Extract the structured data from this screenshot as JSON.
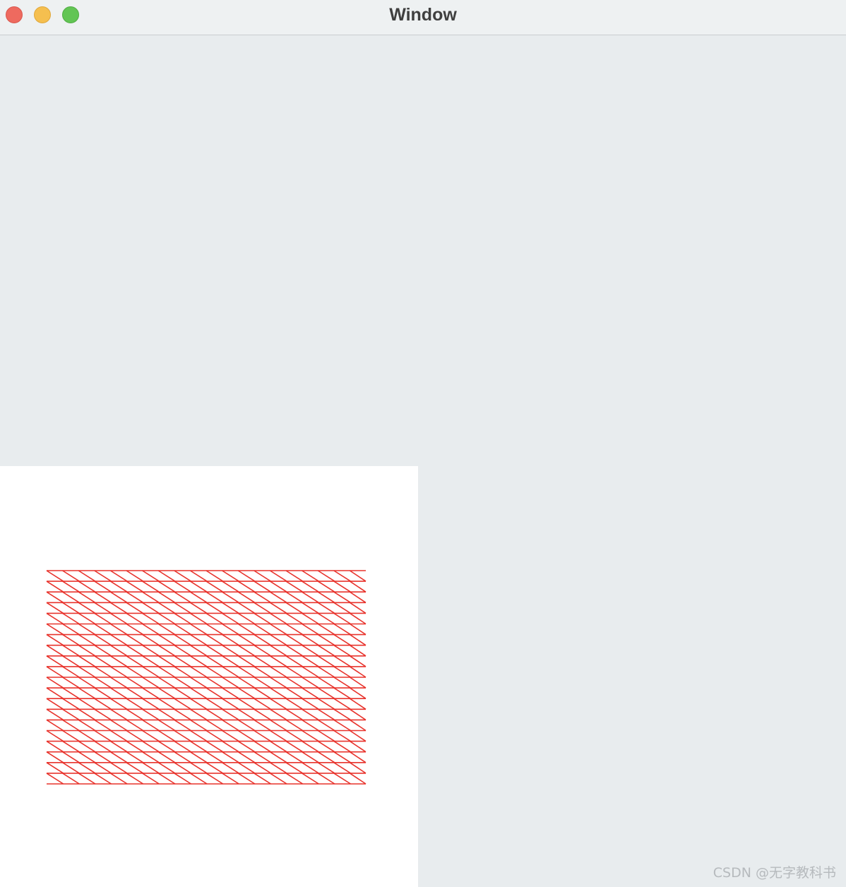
{
  "window": {
    "title": "Window"
  },
  "titlebar_buttons": [
    {
      "name": "close",
      "color": "#ee6a5f"
    },
    {
      "name": "minimize",
      "color": "#f5bf4f"
    },
    {
      "name": "zoom",
      "color": "#62c554"
    }
  ],
  "drawing": {
    "stroke_color": "#e8332c",
    "pattern": "horizontal lines with diagonal hatching"
  },
  "watermark": {
    "text": "CSDN @无字教科书"
  }
}
